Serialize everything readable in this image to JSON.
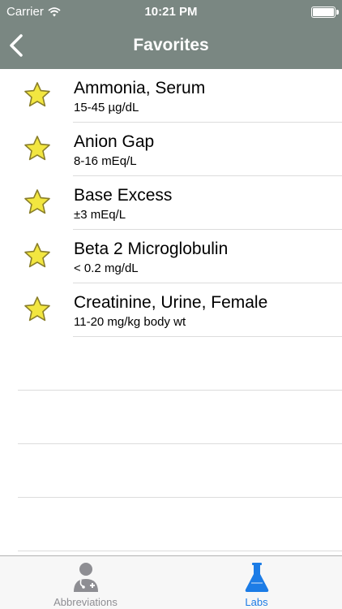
{
  "status_bar": {
    "carrier": "Carrier",
    "time": "10:21 PM"
  },
  "nav": {
    "title": "Favorites",
    "back_icon": "chevron-left-icon"
  },
  "favorites": [
    {
      "name": "Ammonia, Serum",
      "range": "15-45 µg/dL"
    },
    {
      "name": "Anion Gap",
      "range": "8-16 mEq/L"
    },
    {
      "name": "Base Excess",
      "range": "±3 mEq/L"
    },
    {
      "name": "Beta 2 Microglobulin",
      "range": "< 0.2 mg/dL"
    },
    {
      "name": "Creatinine, Urine, Female",
      "range": "11-20 mg/kg body wt"
    }
  ],
  "tab_bar": {
    "tabs": [
      {
        "label": "Abbreviations",
        "icon": "doctor-icon",
        "selected": false
      },
      {
        "label": "Labs",
        "icon": "flask-icon",
        "selected": true
      }
    ]
  },
  "colors": {
    "header": "#7a8782",
    "accent": "#1c7ce6",
    "star": "#f2e640",
    "inactive": "#8e8e93"
  }
}
